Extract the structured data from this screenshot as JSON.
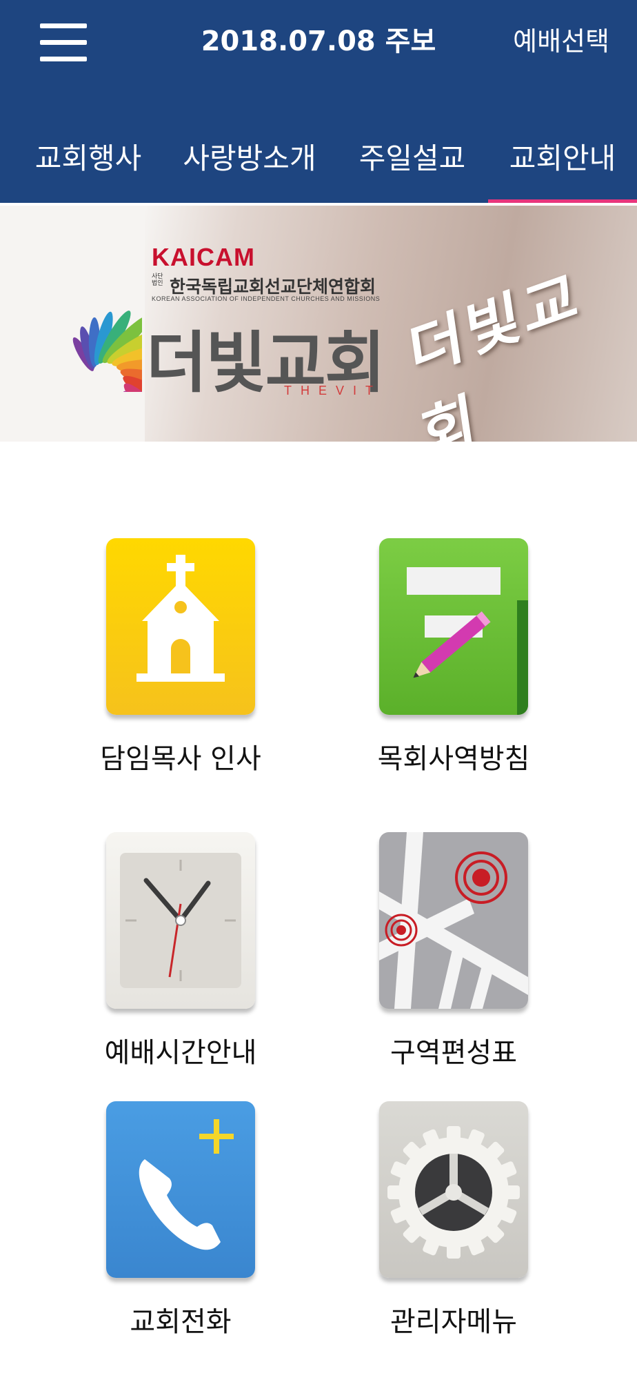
{
  "header": {
    "title": "2018.07.08 주보",
    "select_label": "예배선택",
    "menu_icon": "hamburger-menu-icon",
    "bg_color": "#1e4580"
  },
  "tabs": [
    {
      "label": "교회행사",
      "active": false
    },
    {
      "label": "사랑방소개",
      "active": false
    },
    {
      "label": "주일설교",
      "active": false
    },
    {
      "label": "교회안내",
      "active": true
    }
  ],
  "tab_indicator_color": "#e8357c",
  "banner": {
    "org_short": "KAICAM",
    "org_prefix": "사단법인",
    "org_name": "한국독립교회선교단체연합회",
    "org_english": "KOREAN ASSOCIATION OF INDEPENDENT CHURCHES AND MISSIONS",
    "church_name": "더빛교회",
    "church_english": "THEVIT",
    "sign_text": "더빛교회"
  },
  "menu": [
    {
      "label": "담임목사 인사",
      "icon": "church-icon"
    },
    {
      "label": "목회사역방침",
      "icon": "notepad-pencil-icon"
    },
    {
      "label": "예배시간안내",
      "icon": "clock-icon"
    },
    {
      "label": "구역편성표",
      "icon": "map-icon"
    },
    {
      "label": "교회전화",
      "icon": "phone-add-icon"
    },
    {
      "label": "관리자메뉴",
      "icon": "settings-gear-icon"
    }
  ]
}
